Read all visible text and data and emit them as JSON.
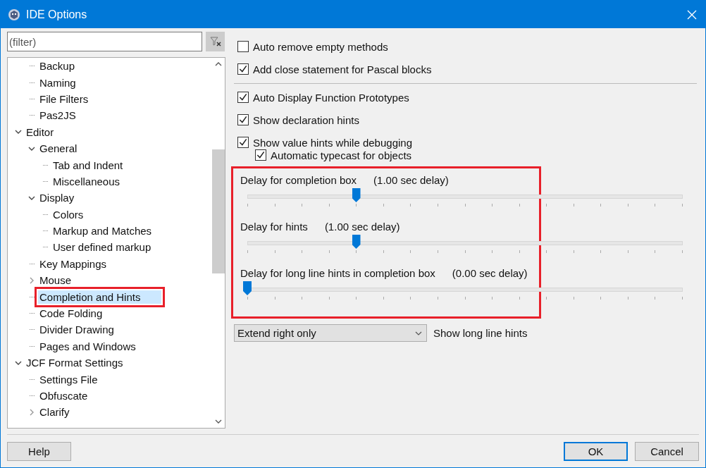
{
  "window": {
    "title": "IDE Options"
  },
  "filter": {
    "placeholder": "(filter)"
  },
  "tree": {
    "continued_children": [
      {
        "label": "Backup",
        "selected": false
      },
      {
        "label": "Naming",
        "selected": false
      },
      {
        "label": "File Filters",
        "selected": false
      },
      {
        "label": "Pas2JS",
        "selected": false
      }
    ],
    "items": [
      {
        "label": "Editor",
        "selected": false,
        "expanded": true,
        "children": [
          {
            "label": "General",
            "selected": false,
            "expanded": true,
            "children": [
              {
                "label": "Tab and Indent",
                "selected": false
              },
              {
                "label": "Miscellaneous",
                "selected": false
              }
            ]
          },
          {
            "label": "Display",
            "selected": false,
            "expanded": true,
            "children": [
              {
                "label": "Colors",
                "selected": false
              },
              {
                "label": "Markup and Matches",
                "selected": false
              },
              {
                "label": "User defined markup",
                "selected": false
              }
            ]
          },
          {
            "label": "Key Mappings",
            "selected": false
          },
          {
            "label": "Mouse",
            "selected": false,
            "expanded": false
          },
          {
            "label": "Completion and Hints",
            "selected": true,
            "highlighted": true
          },
          {
            "label": "Code Folding",
            "selected": false
          },
          {
            "label": "Divider Drawing",
            "selected": false
          },
          {
            "label": "Pages and Windows",
            "selected": false
          }
        ]
      },
      {
        "label": "JCF Format Settings",
        "selected": false,
        "expanded": true,
        "children": [
          {
            "label": "Settings File",
            "selected": false
          },
          {
            "label": "Obfuscate",
            "selected": false
          },
          {
            "label": "Clarify",
            "selected": false,
            "expanded": false
          }
        ]
      }
    ]
  },
  "options_top": [
    {
      "label": "Auto remove empty methods",
      "checked": false
    },
    {
      "label": "Add close statement for Pascal blocks",
      "checked": true
    }
  ],
  "options_hints": [
    {
      "label": "Auto Display Function Prototypes",
      "checked": true
    },
    {
      "label": "Show declaration hints",
      "checked": true
    },
    {
      "label": "Show value hints while debugging",
      "checked": true,
      "children": [
        {
          "label": "Automatic typecast for objects",
          "checked": true
        }
      ]
    }
  ],
  "sliders": {
    "highlighted": true,
    "items": [
      {
        "label": "Delay for completion box",
        "reading": "(1.00 sec delay)",
        "level": 0.25
      },
      {
        "label": "Delay for hints",
        "reading": "(1.00 sec delay)",
        "level": 0.25
      },
      {
        "label": "Delay for long line hints in completion box",
        "reading": "(0.00 sec delay)",
        "level": 0
      }
    ]
  },
  "long_line_hints": {
    "value": "Extend right only",
    "label": "Show long line hints"
  },
  "buttons": {
    "help": "Help",
    "ok": "OK",
    "cancel": "Cancel"
  }
}
